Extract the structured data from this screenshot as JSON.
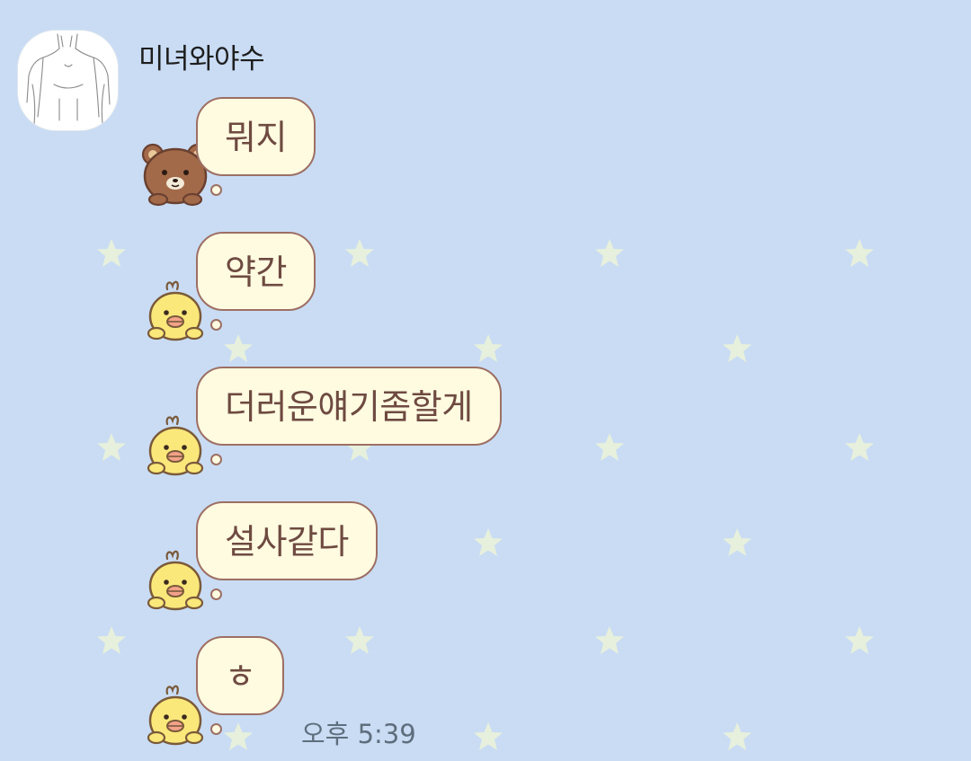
{
  "chat": {
    "sender_name": "미녀와야수",
    "timestamp": "오후 5:39",
    "messages": [
      {
        "text": "뭐지",
        "sticker": "rilakkuma-bear-icon"
      },
      {
        "text": "약간",
        "sticker": "kiiroitori-chick-icon"
      },
      {
        "text": "더러운얘기좀할게",
        "sticker": "kiiroitori-chick-icon"
      },
      {
        "text": "설사같다",
        "sticker": "kiiroitori-chick-icon"
      },
      {
        "text": "ㅎ",
        "sticker": "kiiroitori-chick-icon"
      }
    ]
  },
  "theme": {
    "background": "#c9dcf4",
    "bubble_fill": "#fefbe1",
    "bubble_border": "#9d6f64",
    "text_color": "#6e4a40",
    "star_color": "#e7f0dc"
  }
}
